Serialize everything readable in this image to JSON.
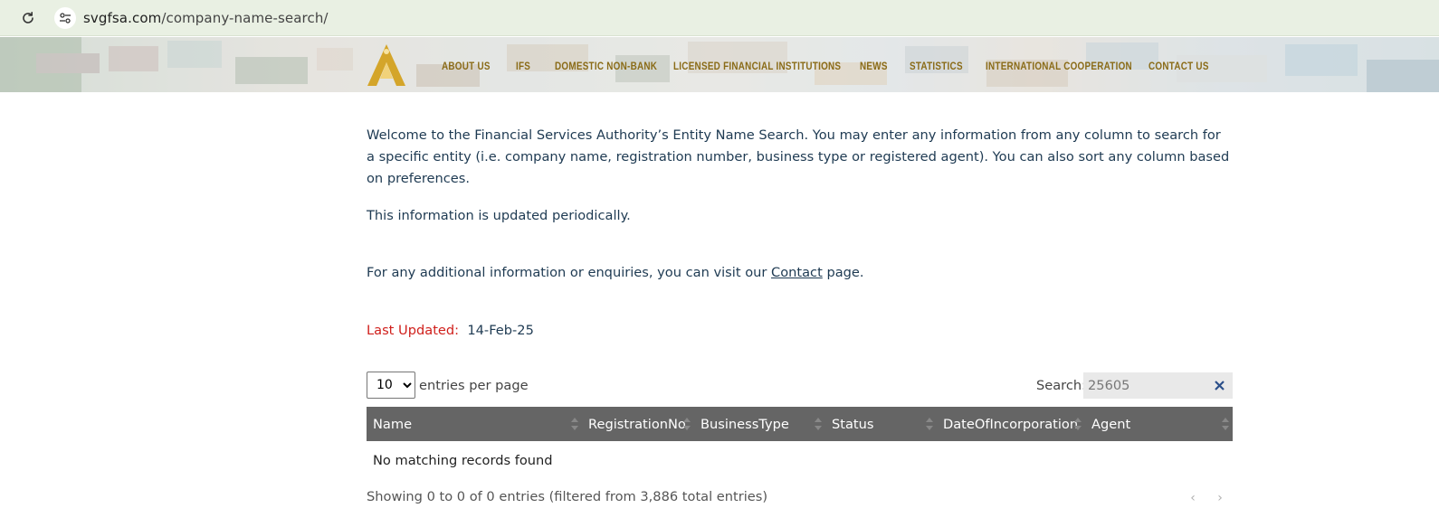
{
  "browser": {
    "url_host": "svgfsa.com",
    "url_path": "/company-name-search/"
  },
  "header": {
    "nav": [
      {
        "label": "ABOUT US"
      },
      {
        "label": "IFS"
      },
      {
        "label": "DOMESTIC NON-BANK"
      },
      {
        "label": "LICENSED FINANCIAL INSTITUTIONS"
      },
      {
        "label": "NEWS"
      },
      {
        "label": "STATISTICS"
      },
      {
        "label": "INTERNATIONAL COOPERATION"
      },
      {
        "label": "CONTACT US"
      }
    ]
  },
  "content": {
    "intro": "Welcome to the Financial Services Authority’s Entity Name Search. You may enter any information from any column to search for a specific entity (i.e. company name, registration number, business type or registered agent). You can also sort any column based on preferences.",
    "updated_note": "This information is updated periodically.",
    "contact_prefix": "For any additional information or enquiries, you can visit our",
    "contact_link": "Contact",
    "contact_suffix": "page.",
    "last_updated_label": "Last Updated:",
    "last_updated_value": "14-Feb-25"
  },
  "table_controls": {
    "entries_value": "10",
    "entries_label": "entries per page",
    "search_label": "Search:",
    "search_value": "25605"
  },
  "table": {
    "columns": [
      "Name",
      "RegistrationNo",
      "BusinessType",
      "Status",
      "DateOfIncorporation",
      "Agent"
    ],
    "empty_message": "No matching records found",
    "info": "Showing 0 to 0 of 0 entries (filtered from 3,886 total entries)",
    "prev_label": "‹",
    "next_label": "›"
  },
  "colors": {
    "nav_text": "#8a6b17",
    "body_text": "#1e3a52",
    "last_updated_label": "#d0201c",
    "table_header_bg": "#656565"
  }
}
